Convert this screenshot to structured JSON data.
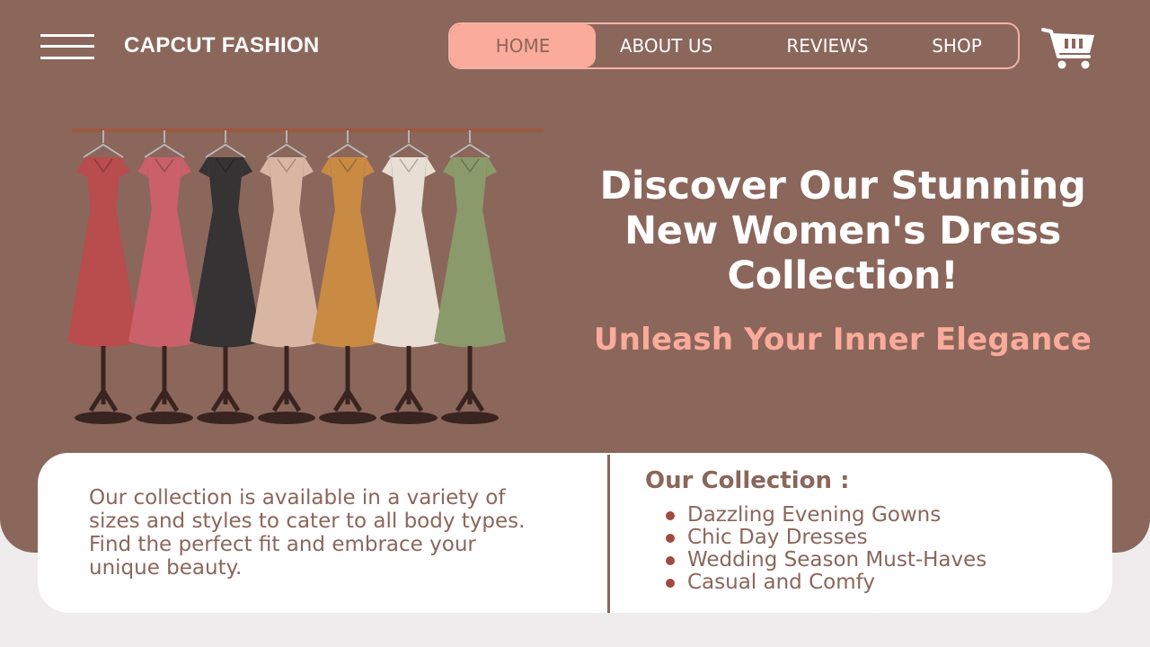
{
  "brand": "CAPCUT FASHION",
  "nav": {
    "items": [
      {
        "label": "HOME",
        "active": true
      },
      {
        "label": "ABOUT US",
        "active": false
      },
      {
        "label": "REVIEWS",
        "active": false
      },
      {
        "label": "SHOP",
        "active": false
      }
    ]
  },
  "icons": {
    "menu": "hamburger-menu-icon",
    "cart": "shopping-cart-icon"
  },
  "hero": {
    "headline_line1": "Discover Our Stunning",
    "headline_line2": "New Women's Dress",
    "headline_line3": "Collection!",
    "tagline": "Unleash Your Inner Elegance",
    "dress_colors": [
      "#b94c4c",
      "#c9606a",
      "#353333",
      "#d9b6a4",
      "#c98a44",
      "#e8ded4",
      "#8a9a6a"
    ]
  },
  "info": {
    "description_line1": "Our collection is available in a variety of",
    "description_line2": "sizes and styles to cater to all body types.",
    "description_line3": "Find the perfect fit and embrace your",
    "description_line4": "unique beauty.",
    "collection_title": "Our Collection :",
    "collection_items": [
      "Dazzling Evening Gowns",
      "Chic Day Dresses",
      "Wedding Season Must-Haves",
      "Casual and Comfy"
    ]
  },
  "colors": {
    "hero_bg": "#8b665b",
    "accent": "#fbab9b",
    "page_bg": "#eeecec",
    "text_brown": "#8b665b"
  }
}
